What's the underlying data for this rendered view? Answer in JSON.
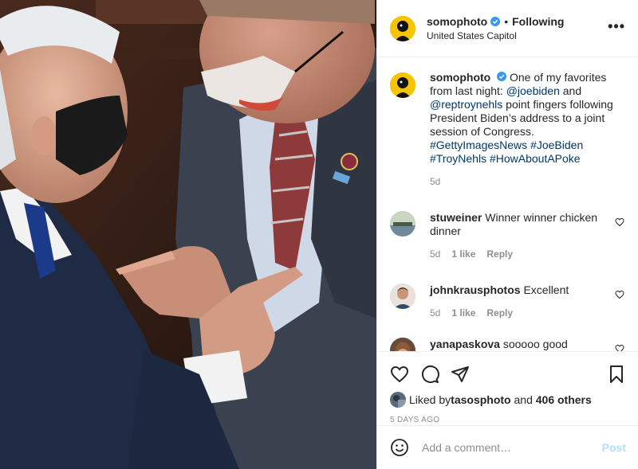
{
  "post": {
    "username": "somophoto",
    "follow_state": "Following",
    "location": "United States Capitol",
    "more_label": "•••"
  },
  "caption": {
    "username": "somophoto",
    "text_before": "One of my favorites from last night: ",
    "mention1": "@joebiden",
    "text_mid": " and ",
    "mention2": "@reptroynehls",
    "text_after": " point fingers following President Biden’s address to a joint session of Congress. ",
    "hashtags": [
      "#GettyImagesNews",
      "#JoeBiden",
      "#TroyNehls",
      "#HowAboutAPoke"
    ],
    "age": "5d"
  },
  "comments": [
    {
      "username": "stuweiner",
      "text": "Winner winner chicken dinner",
      "age": "5d",
      "likes": "1 like",
      "reply": "Reply"
    },
    {
      "username": "johnkrausphotos",
      "text": "Excellent",
      "age": "5d",
      "likes": "1 like",
      "reply": "Reply"
    },
    {
      "username": "yanapaskova",
      "text": "sooooo good"
    }
  ],
  "likes": {
    "prefix": "Liked by ",
    "user": "tasosphoto",
    "mid": " and ",
    "others": "406 others"
  },
  "date": "5 DAYS AGO",
  "add_comment": {
    "placeholder": "Add a comment…",
    "post_label": "Post"
  },
  "colors": {
    "link": "#00376b",
    "verified": "#3897f0",
    "post_disabled": "#b2dffc",
    "avatar_bg": "#f6c400"
  },
  "icons": [
    "verified-icon",
    "more-icon",
    "heart-icon",
    "comment-icon",
    "share-icon",
    "bookmark-icon",
    "emoji-icon"
  ]
}
